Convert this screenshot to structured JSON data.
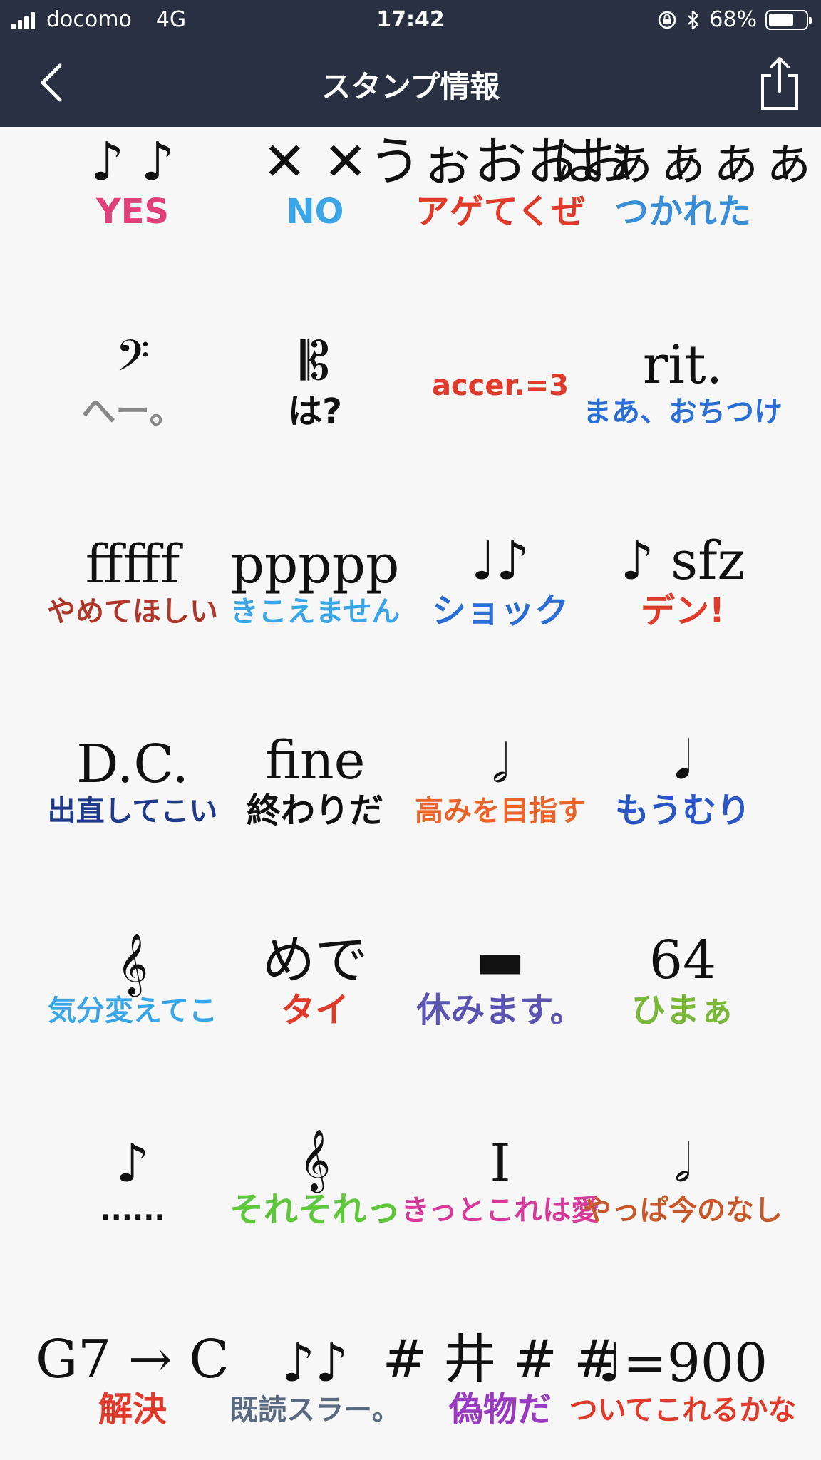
{
  "status": {
    "carrier": "docomo",
    "network": "4G",
    "time": "17:42",
    "battery": "68%",
    "battery_level": 0.68,
    "icons": [
      "signal-icon",
      "rotation-lock-icon",
      "bluetooth-icon",
      "battery-icon"
    ]
  },
  "nav": {
    "title": "スタンプ情報",
    "back_icon": "chevron-left-icon",
    "share_icon": "share-icon"
  },
  "stickers": [
    {
      "symbol": "♪ ♪",
      "label": "YES",
      "color": "#e0407a"
    },
    {
      "symbol": "✕ ✕",
      "label": "NO",
      "color": "#3aa6e8"
    },
    {
      "symbol": "うぉおおお",
      "label": "アゲてくぜ",
      "color": "#e03a2a"
    },
    {
      "symbol": "はぁぁぁぁ",
      "label": "つかれた",
      "color": "#3a8ed8"
    },
    {
      "symbol": "𝄢",
      "label": "へー。",
      "color": "#888888"
    },
    {
      "symbol": "𝄡",
      "label": "は?",
      "color": "#111111"
    },
    {
      "symbol": "",
      "label": "accer.=3",
      "color": "#e03a2a"
    },
    {
      "symbol": "rit.",
      "label": "まあ、おちつけ",
      "color": "#2b6fd6"
    },
    {
      "symbol": "fffff",
      "label": "やめてほしい",
      "color": "#b0382a"
    },
    {
      "symbol": "ppppp",
      "label": "きこえません",
      "color": "#3aa6e8"
    },
    {
      "symbol": "♩♪",
      "label": "ショック",
      "color": "#2b6fd6"
    },
    {
      "symbol": "♪ sfz",
      "label": "デン!",
      "color": "#e03a2a"
    },
    {
      "symbol": "D.C.",
      "label": "出直してこい",
      "color": "#1f3a8a"
    },
    {
      "symbol": "fine",
      "label": "終わりだ",
      "color": "#111111"
    },
    {
      "symbol": "𝅗𝅥",
      "label": "高みを目指す",
      "color": "#e8642a"
    },
    {
      "symbol": "𝅘𝅥",
      "label": "もうむり",
      "color": "#2b56c8"
    },
    {
      "symbol": "𝄞",
      "label": "気分変えてこ",
      "color": "#3aa6e8"
    },
    {
      "symbol": "めで",
      "label": "タイ",
      "color": "#e03a2a"
    },
    {
      "symbol": "▬",
      "label": "休みます。",
      "color": "#5b54b0"
    },
    {
      "symbol": "64",
      "label": "ひまぁ",
      "color": "#7ab83a"
    },
    {
      "symbol": "♪",
      "label": "......",
      "color": "#111111"
    },
    {
      "symbol": "𝄞",
      "label": "それそれっ",
      "color": "#5ec83a"
    },
    {
      "symbol": "I",
      "label": "きっとこれは愛",
      "color": "#d63a9a"
    },
    {
      "symbol": "𝅗𝅥",
      "label": "やっぱ今のなし",
      "color": "#c8582a"
    },
    {
      "symbol": "G7 → C",
      "label": "解決",
      "color": "#e03a2a"
    },
    {
      "symbol": "♪♪",
      "label": "既読スラー。",
      "color": "#5a6a80"
    },
    {
      "symbol": "# 井 # #",
      "label": "偽物だ",
      "color": "#9a3ac0"
    },
    {
      "symbol": "♩=900",
      "label": "ついてこれるかな",
      "color": "#e03a2a"
    }
  ]
}
